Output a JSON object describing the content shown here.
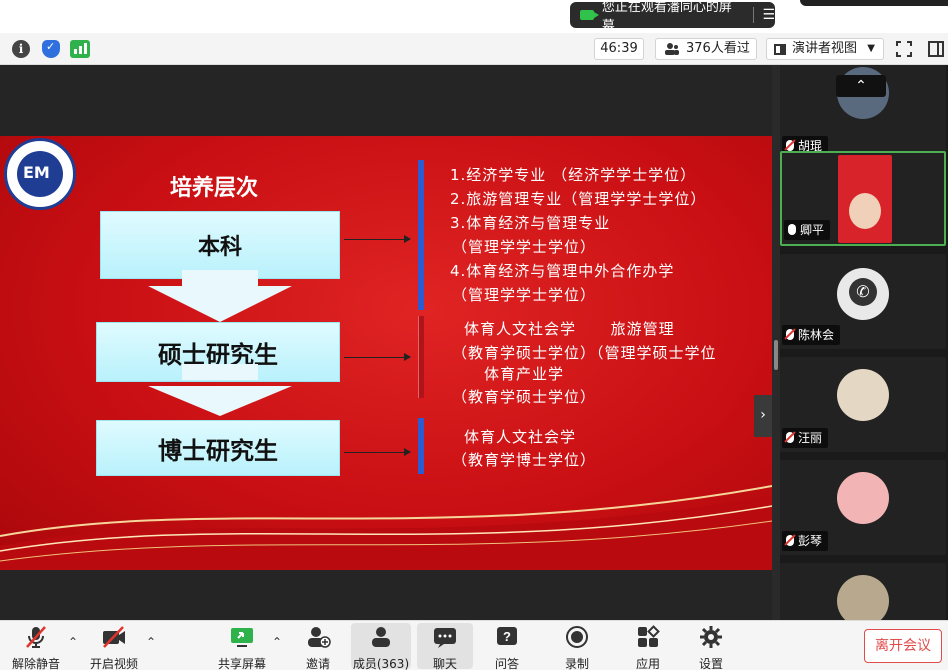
{
  "top": {
    "share_banner": "您正在观看潘同心的屏幕",
    "share_menu_icon": "list-icon"
  },
  "infobar": {
    "icons": [
      "info-icon",
      "shield-icon",
      "signal-icon"
    ],
    "timer": "46:39",
    "viewers": "376人看过",
    "view_mode": "演讲者视图",
    "fullscreen_icon": "fullscreen-icon",
    "panel_icon": "panel-icon"
  },
  "slide": {
    "title": "培养层次",
    "levels": [
      "本科",
      "硕士研究生",
      "博士研究生"
    ],
    "bachelor_lines": [
      "1.经济学专业  （经济学学士学位）",
      "2.旅游管理专业（管理学学士学位）",
      "3.体育经济与管理专业",
      "（管理学学士学位）",
      "4.体育经济与管理中外合作办学",
      "（管理学学士学位）"
    ],
    "master_lines": [
      "体育人文社会学      旅游管理",
      "（教育学硕士学位）（管理学硕士学位",
      "体育产业学",
      "（教育学硕士学位）"
    ],
    "doctor_lines": [
      "体育人文社会学",
      "（教育学博士学位）"
    ]
  },
  "colors": {
    "slide_red": "#c90f13",
    "box_cyan": "#c8f5fc",
    "accent_green": "#4caf50",
    "leave_red": "#e24b4b"
  },
  "gallery": {
    "participants": [
      {
        "name": "胡琨",
        "mic": "muted",
        "active": false,
        "avatar_color": "#5a6a7e"
      },
      {
        "name": "卿平",
        "mic": "on",
        "active": true,
        "avatar_color": "#d8232a"
      },
      {
        "name": "陈林会",
        "mic": "muted",
        "active": false,
        "avatar_color": "#e9e9e9"
      },
      {
        "name": "汪丽",
        "mic": "muted",
        "active": false,
        "avatar_color": "#e4d7c4"
      },
      {
        "name": "彭琴",
        "mic": "muted",
        "active": false,
        "avatar_color": "#f2b4b4"
      }
    ]
  },
  "toolbar": {
    "unmute": "解除静音",
    "start_video": "开启视频",
    "share_screen": "共享屏幕",
    "invite": "邀请",
    "members": "成员(363)",
    "chat": "聊天",
    "qa": "问答",
    "record": "录制",
    "apps": "应用",
    "settings": "设置",
    "leave": "离开会议"
  }
}
